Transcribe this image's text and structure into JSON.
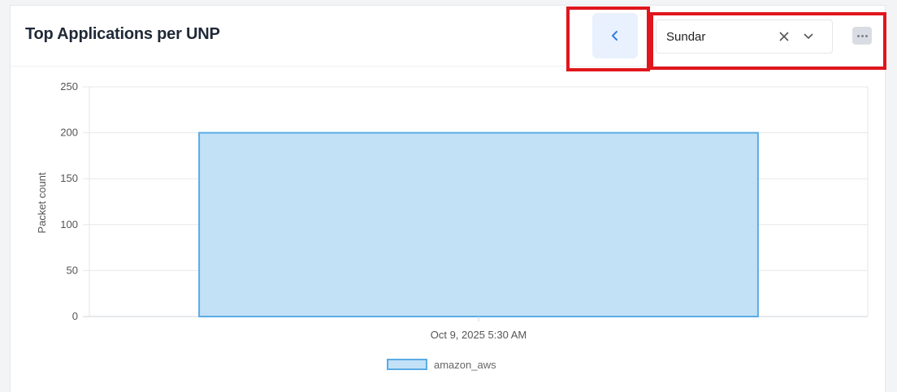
{
  "card": {
    "title": "Top Applications per UNP"
  },
  "controls": {
    "back_icon": "chevron-left-icon",
    "select_value": "Sundar",
    "clear_icon": "close-icon",
    "dropdown_icon": "chevron-down-icon",
    "more_icon": "ellipsis-icon"
  },
  "colors": {
    "bar_fill": "#c2e1f7",
    "bar_stroke": "#5aace4",
    "highlight": "#e0161c",
    "back_button_bg": "#e8f1fd"
  },
  "chart_data": {
    "type": "bar",
    "categories": [
      "Oct 9, 2025 5:30 AM"
    ],
    "series": [
      {
        "name": "amazon_aws",
        "values": [
          200
        ]
      }
    ],
    "title": "",
    "xlabel": "",
    "ylabel": "Packet count",
    "ylim": [
      0,
      250
    ],
    "yticks": [
      0,
      50,
      100,
      150,
      200,
      250
    ],
    "grid": true,
    "legend": "bottom-center"
  }
}
